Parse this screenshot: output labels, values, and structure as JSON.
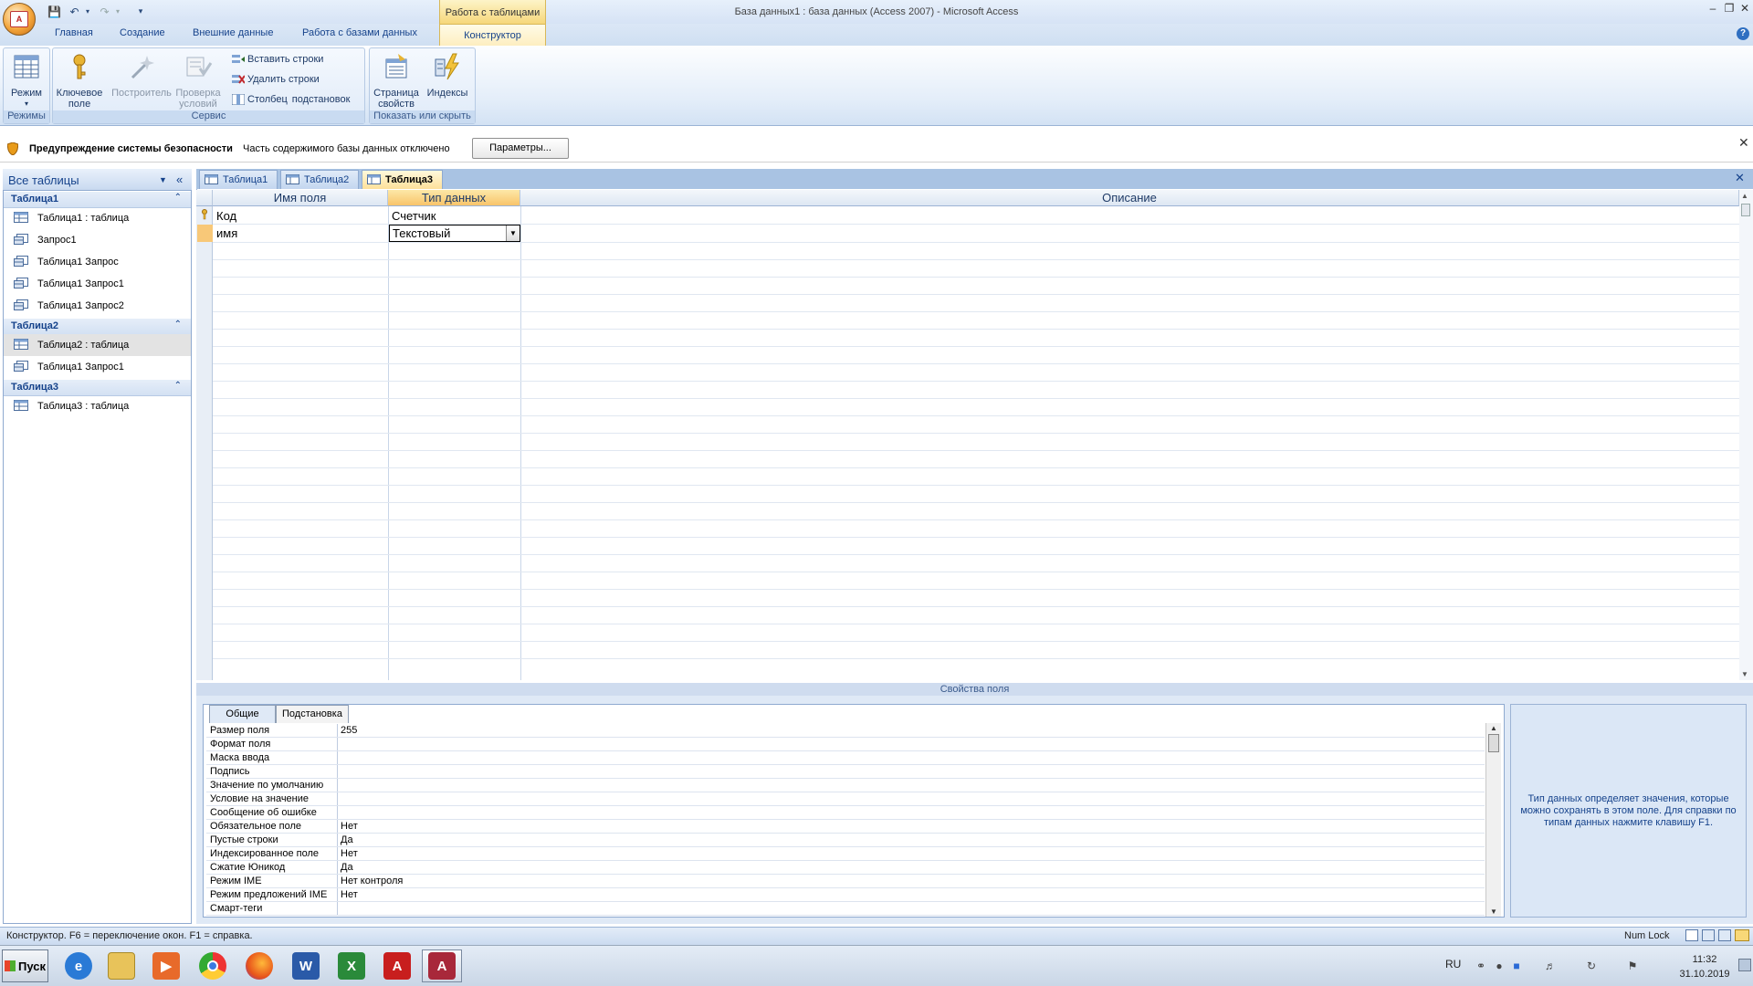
{
  "window": {
    "title": "База данных1 : база данных (Access 2007) - Microsoft Access",
    "context_tab_group": "Работа с таблицами"
  },
  "ribbon": {
    "tabs": [
      "Главная",
      "Создание",
      "Внешние данные",
      "Работа с базами данных",
      "Конструктор"
    ],
    "active_tab": "Конструктор",
    "groups": {
      "modes": {
        "label": "Режимы",
        "btn_mode": "Режим"
      },
      "service": {
        "label": "Сервис",
        "key_field": "Ключевое поле",
        "builder": "Построитель",
        "test_rules": "Проверка условий",
        "insert_rows": "Вставить строки",
        "delete_rows": "Удалить строки",
        "lookup_col_1": "Столбец",
        "lookup_col_2": "подстановок"
      },
      "show_hide": {
        "label": "Показать или скрыть",
        "property_sheet": "Страница свойств",
        "indexes": "Индексы"
      }
    }
  },
  "security_bar": {
    "title": "Предупреждение системы безопасности",
    "message": "Часть содержимого базы данных отключено",
    "button": "Параметры..."
  },
  "nav": {
    "header": "Все таблицы",
    "groups": [
      {
        "name": "Таблица1",
        "items": [
          "Таблица1 : таблица",
          "Запрос1",
          "Таблица1 Запрос",
          "Таблица1 Запрос1",
          "Таблица1 Запрос2"
        ]
      },
      {
        "name": "Таблица2",
        "items": [
          "Таблица2 : таблица",
          "Таблица1 Запрос1"
        ]
      },
      {
        "name": "Таблица3",
        "items": [
          "Таблица3 : таблица"
        ]
      }
    ]
  },
  "doc_tabs": [
    "Таблица1",
    "Таблица2",
    "Таблица3"
  ],
  "active_doc_tab": "Таблица3",
  "design_grid": {
    "headers": {
      "field_name": "Имя поля",
      "data_type": "Тип данных",
      "description": "Описание"
    },
    "rows": [
      {
        "name": "Код",
        "type": "Счетчик",
        "primary_key": true
      },
      {
        "name": "имя",
        "type": "Текстовый",
        "primary_key": false
      }
    ]
  },
  "field_properties": {
    "label": "Свойства поля",
    "tabs": [
      "Общие",
      "Подстановка"
    ],
    "rows": [
      {
        "label": "Размер поля",
        "value": "255"
      },
      {
        "label": "Формат поля",
        "value": ""
      },
      {
        "label": "Маска ввода",
        "value": ""
      },
      {
        "label": "Подпись",
        "value": ""
      },
      {
        "label": "Значение по умолчанию",
        "value": ""
      },
      {
        "label": "Условие на значение",
        "value": ""
      },
      {
        "label": "Сообщение об ошибке",
        "value": ""
      },
      {
        "label": "Обязательное поле",
        "value": "Нет"
      },
      {
        "label": "Пустые строки",
        "value": "Да"
      },
      {
        "label": "Индексированное поле",
        "value": "Нет"
      },
      {
        "label": "Сжатие Юникод",
        "value": "Да"
      },
      {
        "label": "Режим IME",
        "value": "Нет контроля"
      },
      {
        "label": "Режим предложений IME",
        "value": "Нет"
      },
      {
        "label": "Смарт-теги",
        "value": ""
      }
    ],
    "help": "Тип данных определяет значения, которые можно сохранять в этом поле. Для справки по типам данных нажмите клавишу F1."
  },
  "status": {
    "text": "Конструктор.  F6 = переключение окон.  F1 = справка.",
    "numlock": "Num Lock"
  },
  "taskbar": {
    "start": "Пуск",
    "apps": [
      "internet-explorer-icon",
      "file-explorer-icon",
      "media-player-icon",
      "chrome-icon",
      "firefox-icon",
      "word-icon",
      "excel-icon",
      "acrobat-icon",
      "access-icon"
    ],
    "lang": "RU",
    "time": "11:32",
    "date": "31.10.2019"
  },
  "colors": {
    "ribbon_accent": "#15428b",
    "context_tab": "#f6d77a",
    "selected_row": "#f8c878"
  }
}
